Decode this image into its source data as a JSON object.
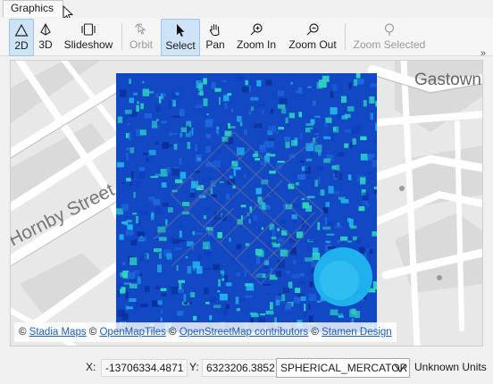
{
  "tab": {
    "title": "Graphics"
  },
  "toolbar": {
    "buttons": [
      {
        "label": "2D",
        "icon": "triangle-2d-icon",
        "state": "active"
      },
      {
        "label": "3D",
        "icon": "pyramid-3d-icon",
        "state": "normal"
      },
      {
        "label": "Slideshow",
        "icon": "slideshow-icon",
        "state": "normal"
      },
      {
        "label": "Orbit",
        "icon": "orbit-icon",
        "state": "disabled"
      },
      {
        "label": "Select",
        "icon": "arrow-pointer-icon",
        "state": "active"
      },
      {
        "label": "Pan",
        "icon": "hand-icon",
        "state": "normal"
      },
      {
        "label": "Zoom In",
        "icon": "zoom-in-icon",
        "state": "normal"
      },
      {
        "label": "Zoom Out",
        "icon": "zoom-out-icon",
        "state": "normal"
      },
      {
        "label": "Zoom Selected",
        "icon": "zoom-selected-icon",
        "state": "disabled"
      }
    ],
    "overflow": "»"
  },
  "map": {
    "labels": {
      "street": "Hornby Street",
      "area": "Gastown"
    },
    "attribution": [
      {
        "text": "© ",
        "link": false
      },
      {
        "text": "Stadia Maps",
        "link": true
      },
      {
        "text": " © ",
        "link": false
      },
      {
        "text": "OpenMapTiles",
        "link": true
      },
      {
        "text": " © ",
        "link": false
      },
      {
        "text": "OpenStreetMap contributors",
        "link": true
      },
      {
        "text": " © ",
        "link": false
      },
      {
        "text": "Stamen Design",
        "link": true
      }
    ],
    "colors": {
      "data_dark": "#0f3fbf",
      "data_mid": "#1e66dd",
      "data_light": "#22b3ee",
      "data_accent": "#2ed6c0"
    }
  },
  "status": {
    "x_label": "X:",
    "x_value": "-13706334.4871",
    "y_label": "Y:",
    "y_value": "6323206.3852",
    "projection": "SPHERICAL_MERCATOR",
    "units": "Unknown Units"
  }
}
